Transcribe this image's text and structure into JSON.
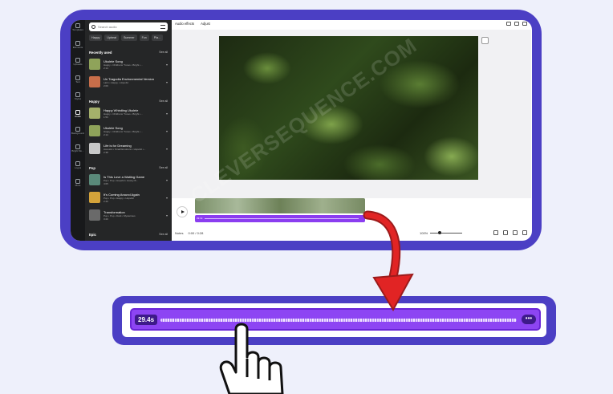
{
  "rail": [
    {
      "label": "Templates",
      "active": false
    },
    {
      "label": "Elements",
      "active": false
    },
    {
      "label": "Uploads",
      "active": false
    },
    {
      "label": "Text",
      "active": false
    },
    {
      "label": "Styles",
      "active": false
    },
    {
      "label": "Audio",
      "active": true
    },
    {
      "label": "Background",
      "active": false
    },
    {
      "label": "Bright Mo...",
      "active": false
    },
    {
      "label": "Logos",
      "active": false
    },
    {
      "label": "More",
      "active": false
    }
  ],
  "panel": {
    "search_placeholder": "Search audio",
    "chips": [
      "Happy",
      "Upbeat",
      "Summer",
      "Fun",
      "Pla..."
    ],
    "sections": [
      {
        "title": "Recently used",
        "see_all": "See all"
      },
      {
        "title": "Happy",
        "see_all": "See all"
      },
      {
        "title": "Pop",
        "see_all": "See all"
      },
      {
        "title": "Epic",
        "see_all": "See all"
      }
    ],
    "tracks": [
      {
        "name": "Ukulele Song",
        "meta": "Happy • Childrens' Tunes • Bright •...",
        "dur": "2:14",
        "color": "#8fa35a"
      },
      {
        "name": "Un Tragudia Environmental Version",
        "meta": "Latin • Happy • Hopeful",
        "dur": "2:09",
        "color": "#c86e4a"
      },
      {
        "name": "Happy Whistling Ukulele",
        "meta": "Happy • Childrens' Tunes • Bright •...",
        "dur": "1:53",
        "color": "#a4b06b"
      },
      {
        "name": "Ukulele Song",
        "meta": "Happy • Childrens' Tunes • Bright •...",
        "dur": "2:14",
        "color": "#8fa35a"
      },
      {
        "name": "Life is for Dreaming",
        "meta": "Acoustic • Small Emotions • Hopeful •...",
        "dur": "2:38",
        "color": "#c8c8c8"
      },
      {
        "name": "Is This Love a Waiting Game",
        "meta": "Pop • Pop • Hopeful • Heavy B...",
        "dur": "4:05",
        "color": "#5a8a7a"
      },
      {
        "name": "It's Coming Around Again",
        "meta": "Pop • Pop • Happy • Hopeful",
        "dur": "2:40",
        "color": "#d4a33a"
      },
      {
        "name": "Transformation",
        "meta": "Pop • Pop • Dark • Mysterious",
        "dur": "3:20",
        "color": "#6a6a6a"
      }
    ]
  },
  "editor": {
    "tabs": [
      "Audio effects",
      "Adjust"
    ],
    "notes_label": "Notes",
    "time": "0:00 / 0:28",
    "zoom": "100%",
    "audio_clip_label": "29.4s"
  },
  "watermark": "CLEVERSEQUENCE.COM",
  "callout": {
    "duration": "29.4s",
    "more": "•••"
  }
}
